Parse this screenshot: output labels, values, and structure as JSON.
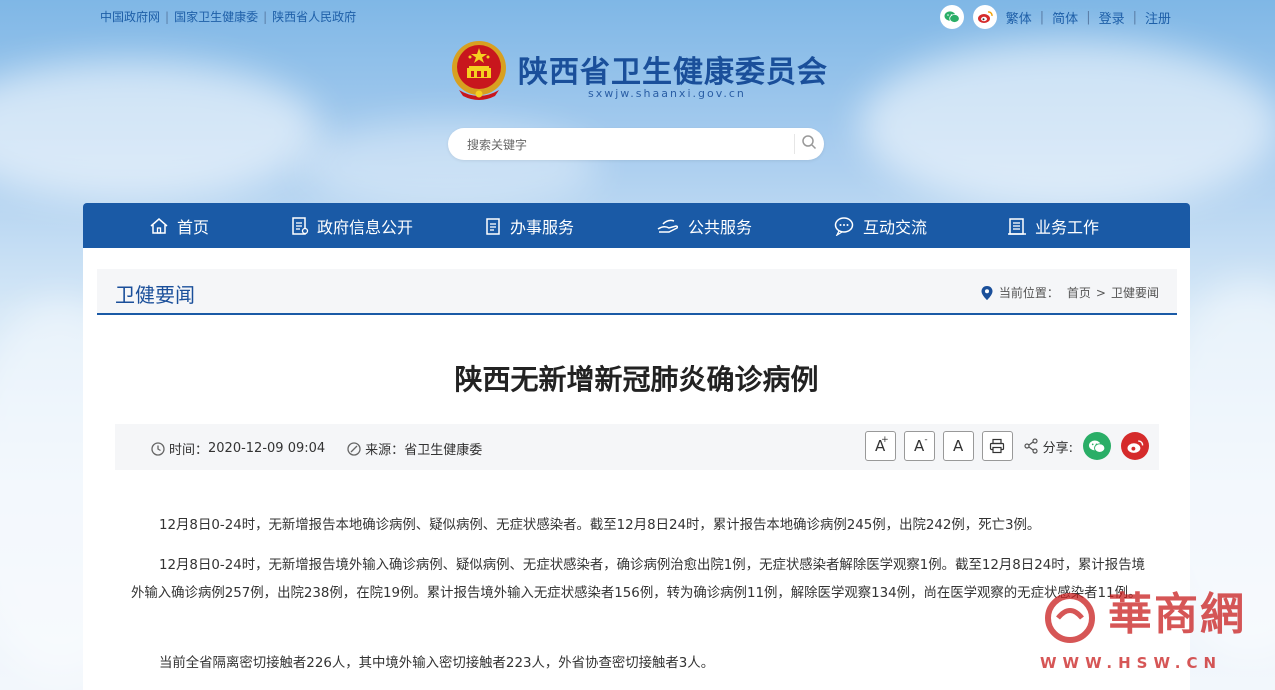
{
  "top_links": [
    "中国政府网",
    "国家卫生健康委",
    "陕西省人民政府"
  ],
  "top_right": {
    "icons": [
      "wechat-icon",
      "weibo-icon"
    ],
    "links": [
      "繁体",
      "简体",
      "登录",
      "注册"
    ]
  },
  "site": {
    "title": "陕西省卫生健康委员会",
    "domain": "sxwjw.shaanxi.gov.cn"
  },
  "search": {
    "placeholder": "搜索关键字"
  },
  "nav": [
    {
      "label": "首页",
      "icon": "home-icon"
    },
    {
      "label": "政府信息公开",
      "icon": "document-icon"
    },
    {
      "label": "办事服务",
      "icon": "clipboard-icon"
    },
    {
      "label": "公共服务",
      "icon": "hand-icon"
    },
    {
      "label": "互动交流",
      "icon": "chat-icon"
    },
    {
      "label": "业务工作",
      "icon": "briefcase-icon"
    }
  ],
  "section": {
    "title": "卫健要闻",
    "breadcrumb_prefix": "当前位置：",
    "breadcrumb": [
      "首页",
      "卫健要闻"
    ],
    "separator": ">"
  },
  "article": {
    "title": "陕西无新增新冠肺炎确诊病例",
    "time_label": "时间：",
    "time": "2020-12-09 09:04",
    "source_label": "来源：",
    "source": "省卫生健康委",
    "share_label": "分享:",
    "font_buttons": [
      "A",
      "A",
      "A"
    ],
    "font_button_sups": [
      "+",
      "-"
    ],
    "paragraphs": [
      "12月8日0-24时，无新增报告本地确诊病例、疑似病例、无症状感染者。截至12月8日24时，累计报告本地确诊病例245例，出院242例，死亡3例。",
      "12月8日0-24时，无新增报告境外输入确诊病例、疑似病例、无症状感染者，确诊病例治愈出院1例，无症状感染者解除医学观察1例。截至12月8日24时，累计报告境外输入确诊病例257例，出院238例，在院19例。累计报告境外输入无症状感染者156例，转为确诊病例11例，解除医学观察134例，尚在医学观察的无症状感染者11例。",
      "当前全省隔离密切接触者226人，其中境外输入密切接触者223人，外省协查密切接触者3人。"
    ]
  },
  "watermark": {
    "text": "華商網",
    "url": "WWW.HSW.CN"
  },
  "colors": {
    "brand": "#1a5aa6",
    "title": "#1a4f9a",
    "wechat": "#2aae67",
    "weibo": "#d52b2b"
  }
}
